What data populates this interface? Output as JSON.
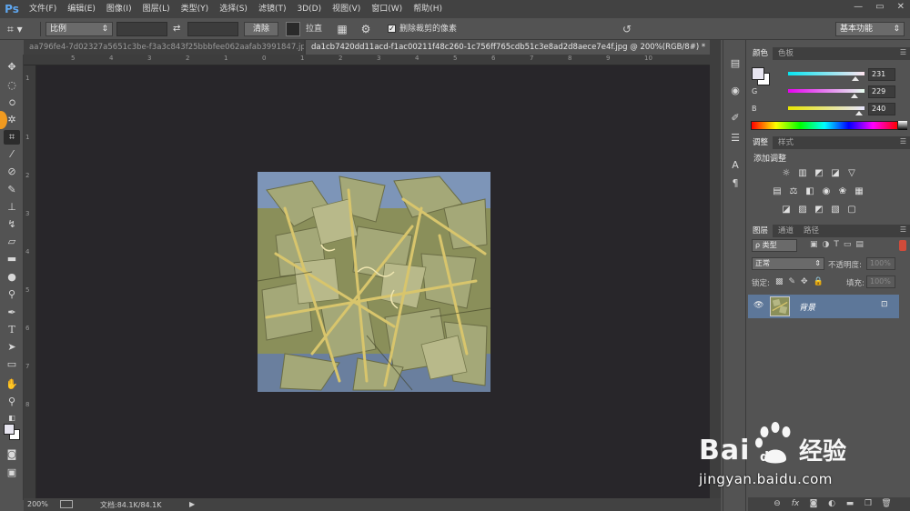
{
  "app": {
    "logo": "Ps"
  },
  "menu": [
    "文件(F)",
    "编辑(E)",
    "图像(I)",
    "图层(L)",
    "类型(Y)",
    "选择(S)",
    "滤镜(T)",
    "3D(D)",
    "视图(V)",
    "窗口(W)",
    "帮助(H)"
  ],
  "window_controls": {
    "minimize": "—",
    "restore": "▭",
    "close": "✕"
  },
  "options_bar": {
    "ratio_select": "比例",
    "swap_symbol": "⇄",
    "clear_button": "清除",
    "straighten_label": "拉直",
    "delete_cropped_label": "删除裁剪的像素",
    "delete_cropped_checked": true,
    "workspace_select": "基本功能"
  },
  "tabs": [
    {
      "label": "aa796fe4-7d02327a5651c3be-f3a3c843f25bbbfee062aafab3991847.jpg",
      "close": "✕",
      "active": false
    },
    {
      "label": "da1cb7420dd11acd-f1ac00211f48c260-1c756ff765cdb51c3e8ad2d8aece7e4f.jpg @ 200%(RGB/8#) *",
      "close": "✕",
      "active": true
    }
  ],
  "ruler_top_labels": [
    "5",
    "4",
    "3",
    "2",
    "1",
    "0",
    "1",
    "2",
    "3",
    "4",
    "5",
    "6",
    "7",
    "8",
    "9",
    "10"
  ],
  "ruler_left_labels": [
    "1",
    "1",
    "2",
    "3",
    "4",
    "5",
    "6",
    "7",
    "8"
  ],
  "status": {
    "zoom": "200%",
    "doc_info": "文档:84.1K/84.1K",
    "arrow": "▶"
  },
  "color_panel": {
    "tabs": [
      "颜色",
      "色板"
    ],
    "channels": [
      {
        "label": "R",
        "value": "231"
      },
      {
        "label": "G",
        "value": "229"
      },
      {
        "label": "B",
        "value": "240"
      }
    ],
    "foreground": "#e7e5f0"
  },
  "adjustments_panel": {
    "tabs": [
      "调整",
      "样式"
    ],
    "title": "添加调整"
  },
  "layers_panel": {
    "tabs": [
      "图层",
      "通道",
      "路径"
    ],
    "kind_filter": "ρ 类型",
    "blend_mode": "正常",
    "opacity_label": "不透明度:",
    "opacity_value": "100%",
    "lock_label": "锁定:",
    "fill_label": "填充:",
    "fill_value": "100%",
    "layer_name": "背景",
    "footer_icons": [
      "link-icon",
      "fx-icon",
      "mask-icon",
      "adjustment-icon",
      "group-icon",
      "new-layer-icon",
      "trash-icon"
    ]
  },
  "watermark": {
    "text": "jingyan.baidu.com",
    "brand": "Bai 经验"
  }
}
